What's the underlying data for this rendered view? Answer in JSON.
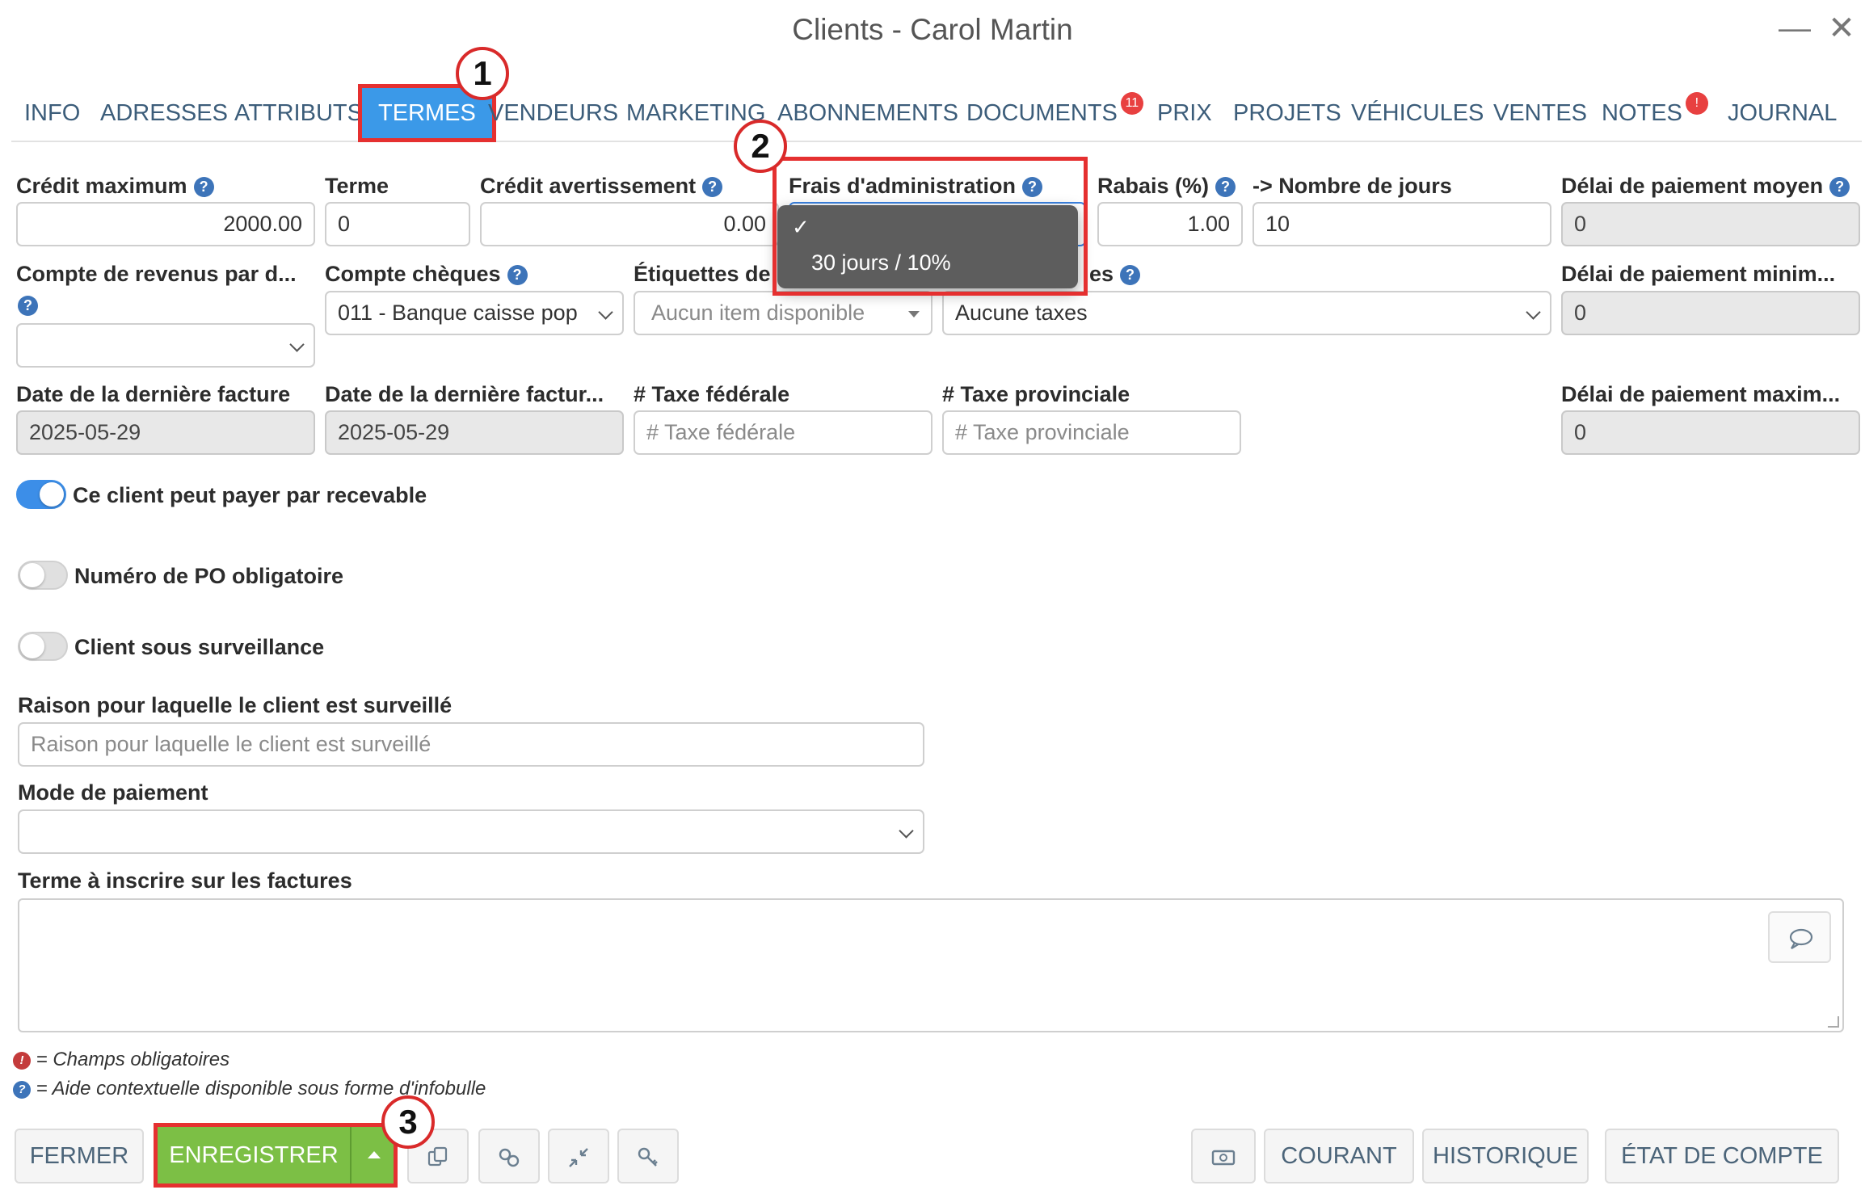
{
  "window": {
    "title": "Clients - Carol Martin",
    "minimize_glyph": "—",
    "close_glyph": "✕"
  },
  "tabs": [
    {
      "label": "INFO"
    },
    {
      "label": "ADRESSES"
    },
    {
      "label": "ATTRIBUTS"
    },
    {
      "label": "TERMES"
    },
    {
      "label": "VENDEURS"
    },
    {
      "label": "MARKETING"
    },
    {
      "label": "ABONNEMENTS"
    },
    {
      "label": "DOCUMENTS",
      "badge": "11"
    },
    {
      "label": "PRIX"
    },
    {
      "label": "PROJETS"
    },
    {
      "label": "VÉHICULES"
    },
    {
      "label": "VENTES"
    },
    {
      "label": "NOTES",
      "badge": "!"
    },
    {
      "label": "JOURNAL"
    }
  ],
  "fields": {
    "credit_max": {
      "label": "Crédit maximum",
      "value": "2000.00"
    },
    "terme": {
      "label": "Terme",
      "value": "0"
    },
    "credit_avert": {
      "label": "Crédit avertissement",
      "value": "0.00"
    },
    "frais_admin": {
      "label": "Frais d'administration",
      "value": ""
    },
    "rabais": {
      "label": "Rabais (%)",
      "value": "1.00"
    },
    "nb_jours": {
      "label": "-> Nombre de jours",
      "value": "10"
    },
    "delai_moyen": {
      "label": "Délai de paiement moyen",
      "value": "0"
    },
    "compte_revenus": {
      "label": "Compte de revenus par d...",
      "value": ""
    },
    "compte_cheques": {
      "label": "Compte chèques",
      "value": "011 - Banque caisse pop"
    },
    "etiquettes": {
      "label": "Étiquettes de",
      "placeholder": "Aucun item disponible"
    },
    "taxes": {
      "label_suffix": "es",
      "value": "Aucune taxes"
    },
    "delai_min": {
      "label": "Délai de paiement minim...",
      "value": "0"
    },
    "date_derniere_facture": {
      "label": "Date de la dernière facture",
      "value": "2025-05-29"
    },
    "date_derniere_factur2": {
      "label": "Date de la dernière factur...",
      "value": "2025-05-29"
    },
    "taxe_federale": {
      "label": "# Taxe fédérale",
      "placeholder": "# Taxe fédérale"
    },
    "taxe_provinciale": {
      "label": "# Taxe provinciale",
      "placeholder": "# Taxe provinciale"
    },
    "delai_max": {
      "label": "Délai de paiement maxim...",
      "value": "0"
    },
    "raison": {
      "label": "Raison pour laquelle le client est surveillé",
      "placeholder": "Raison pour laquelle le client est surveillé"
    },
    "mode_paiement": {
      "label": "Mode de paiement",
      "value": ""
    },
    "terme_factures": {
      "label": "Terme à inscrire sur les factures"
    }
  },
  "toggles": {
    "recevable": {
      "label": "Ce client peut payer par recevable",
      "on": true
    },
    "po": {
      "label": "Numéro de PO obligatoire",
      "on": false
    },
    "surveillance": {
      "label": "Client sous surveillance",
      "on": false
    }
  },
  "dropdown": {
    "check": "✓",
    "option": "30 jours / 10%"
  },
  "legend": {
    "required_icon": "!",
    "required": " = Champs obligatoires",
    "help_icon": "?",
    "help": " = Aide contextuelle disponible sous forme d'infobulle"
  },
  "buttons": {
    "fermer": "FERMER",
    "enregistrer": "ENREGISTRER",
    "courant": "COURANT",
    "historique": "HISTORIQUE",
    "etat_compte": "ÉTAT DE COMPTE"
  },
  "callouts": [
    "1",
    "2",
    "3"
  ],
  "colors": {
    "accent": "#3b99e8",
    "save_green": "#7cbf45",
    "highlight_red": "#e53030",
    "help_blue": "#3d74b9"
  }
}
